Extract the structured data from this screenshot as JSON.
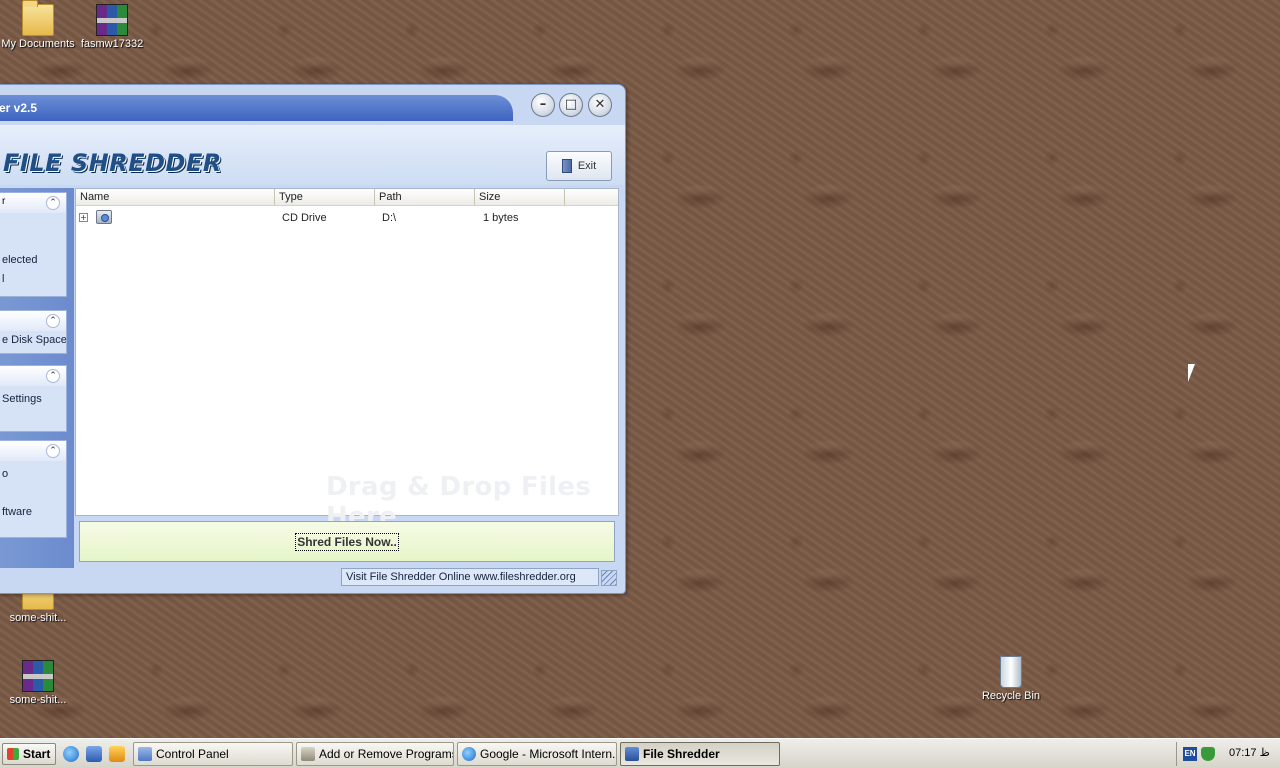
{
  "desktop": {
    "icons": [
      {
        "label": "My Documents",
        "icon": "folder-icon"
      },
      {
        "label": "fasmw17332",
        "icon": "winrar-archive-icon"
      },
      {
        "label": "some-shit...",
        "icon": "folder-icon"
      },
      {
        "label": "some-shit...",
        "icon": "winrar-archive-icon"
      },
      {
        "label": "Recycle Bin",
        "icon": "recycle-bin-icon"
      }
    ]
  },
  "window": {
    "title": "er v2.5",
    "brand": "FILE SHREDDER",
    "exit_label": "Exit",
    "side_groups": [
      {
        "header": "r",
        "items": [
          "",
          "",
          "elected",
          "l"
        ]
      },
      {
        "header": "",
        "items": [
          "e Disk Space"
        ]
      },
      {
        "header": "",
        "items": [
          "Settings"
        ]
      },
      {
        "header": "",
        "items": [
          "o",
          "",
          "ftware"
        ]
      }
    ],
    "columns": [
      "Name",
      "Type",
      "Path",
      "Size"
    ],
    "rows": [
      {
        "expander": "+",
        "icon": "cd-drive-icon",
        "name": "",
        "type": "CD Drive",
        "path": "D:\\",
        "size": "1 bytes"
      }
    ],
    "drop_hint": "Drag & Drop Files Here",
    "shred_label": "Shred Files Now..",
    "status_text": "Visit File Shredder Online   www.fileshredder.org"
  },
  "taskbar": {
    "start_label": "Start",
    "tasks": [
      {
        "label": "Control Panel",
        "active": false
      },
      {
        "label": "Add or Remove Programs",
        "active": false
      },
      {
        "label": "Google - Microsoft Intern...",
        "active": false
      },
      {
        "label": "File Shredder",
        "active": true
      }
    ],
    "lang": "EN",
    "clock": "07:17 ظ"
  },
  "colors": {
    "title_blue": "#3d64c1",
    "brand_blue": "#1f4f86",
    "shred_bar_green": "#e6f5c8"
  }
}
